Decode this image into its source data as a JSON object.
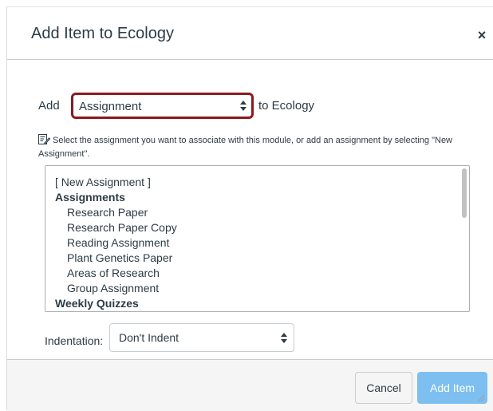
{
  "dialog": {
    "title": "Add Item to Ecology",
    "close_label": "×"
  },
  "add_row": {
    "prefix": "Add",
    "selected_type": "Assignment",
    "suffix": "to Ecology"
  },
  "help_text": "Select the assignment you want to associate with this module, or add an assignment by selecting \"New Assignment\".",
  "list": {
    "new_option": "[ New Assignment ]",
    "groups": [
      {
        "label": "Assignments",
        "items": [
          "Research Paper",
          "Research Paper Copy",
          "Reading Assignment",
          "Plant Genetics Paper",
          "Areas of Research",
          "Group Assignment"
        ]
      },
      {
        "label": "Weekly Quizzes",
        "items": []
      }
    ]
  },
  "indentation": {
    "label": "Indentation:",
    "selected": "Don't Indent"
  },
  "footer": {
    "cancel_label": "Cancel",
    "add_label": "Add Item"
  },
  "colors": {
    "highlight_border": "#8b1a1f",
    "primary_button": "#7dbff0",
    "text": "#2d3b45"
  }
}
